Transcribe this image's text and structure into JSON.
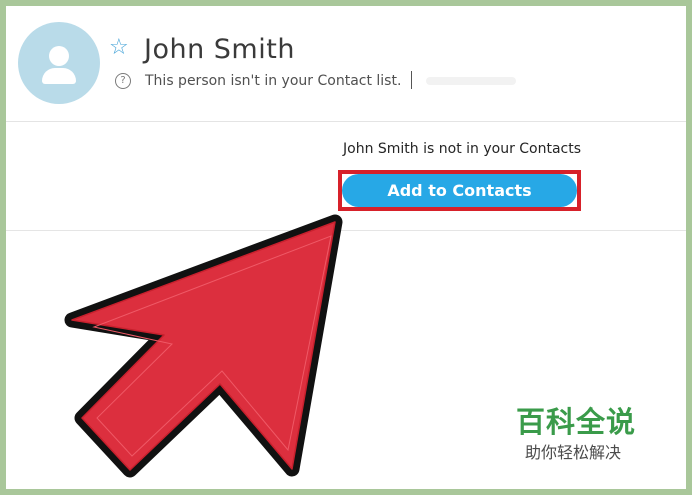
{
  "contact": {
    "name": "John Smith",
    "status": "This person isn't in your Contact list.",
    "notice": "John Smith is not in your Contacts",
    "add_button": "Add to Contacts"
  },
  "icons": {
    "favorite": "star-outline-icon",
    "help": "question-circle-icon",
    "avatar": "user-avatar-icon",
    "pointer": "arrow-pointer-icon"
  },
  "watermark": {
    "title": "百科全说",
    "subtitle": "助你轻松解决"
  },
  "colors": {
    "accent": "#27a8e6",
    "highlight": "#d7212a",
    "arrow": "#dc2f3e",
    "avatar": "#b9dbe9",
    "watermark": "#3a9b4a"
  }
}
